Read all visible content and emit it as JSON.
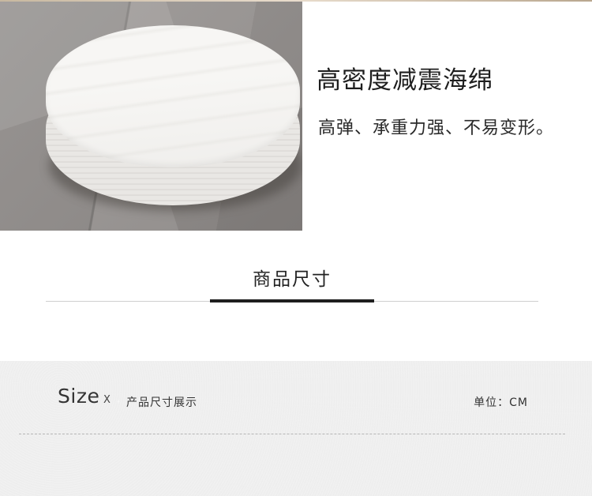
{
  "feature": {
    "title": "高密度减震海绵",
    "subtitle": "高弹、承重力强、不易变形。"
  },
  "section": {
    "title": "商品尺寸"
  },
  "size_panel": {
    "label": "Size",
    "separator": "X",
    "description": "产品尺寸展示",
    "unit": "单位：CM"
  },
  "colors": {
    "accent_line": "#1f1f1f",
    "panel_bg": "#efefef"
  }
}
